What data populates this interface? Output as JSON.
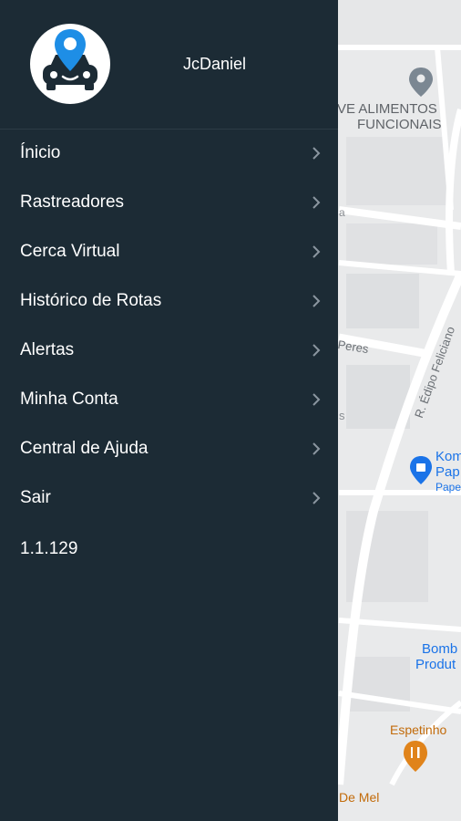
{
  "app": {
    "username": "JcDaniel",
    "version": "1.1.129"
  },
  "menu": {
    "items": [
      {
        "label": "Ínicio",
        "icon": "chevron-right-icon"
      },
      {
        "label": "Rastreadores",
        "icon": "chevron-right-icon"
      },
      {
        "label": "Cerca Virtual",
        "icon": "chevron-right-icon"
      },
      {
        "label": "Histórico de Rotas",
        "icon": "chevron-right-icon"
      },
      {
        "label": "Alertas",
        "icon": "chevron-right-icon"
      },
      {
        "label": "Minha Conta",
        "icon": "chevron-right-icon"
      },
      {
        "label": "Central de Ajuda",
        "icon": "chevron-right-icon"
      },
      {
        "label": "Sair",
        "icon": "chevron-right-icon"
      }
    ]
  },
  "map": {
    "labels": {
      "alimentos_1": "VE ALIMENTOS",
      "alimentos_2": "FUNCIONAIS",
      "street_a": "a",
      "peres": "Peres",
      "s_letter": "s",
      "edipo": "R. Édipo Feliciano",
      "kom": "Kom",
      "pap": "Pap",
      "pape": "Pape",
      "bomb": "Bomb",
      "produt": "Produt",
      "espetinho": "Espetinho",
      "demel": "De Mel"
    },
    "colors": {
      "place_blue": "#1a73e8",
      "food_orange": "#c26b0a",
      "text_gray": "#5f6368"
    }
  },
  "colors": {
    "drawer_bg": "#1c2b35",
    "accent_blue": "#1e8ee6"
  }
}
